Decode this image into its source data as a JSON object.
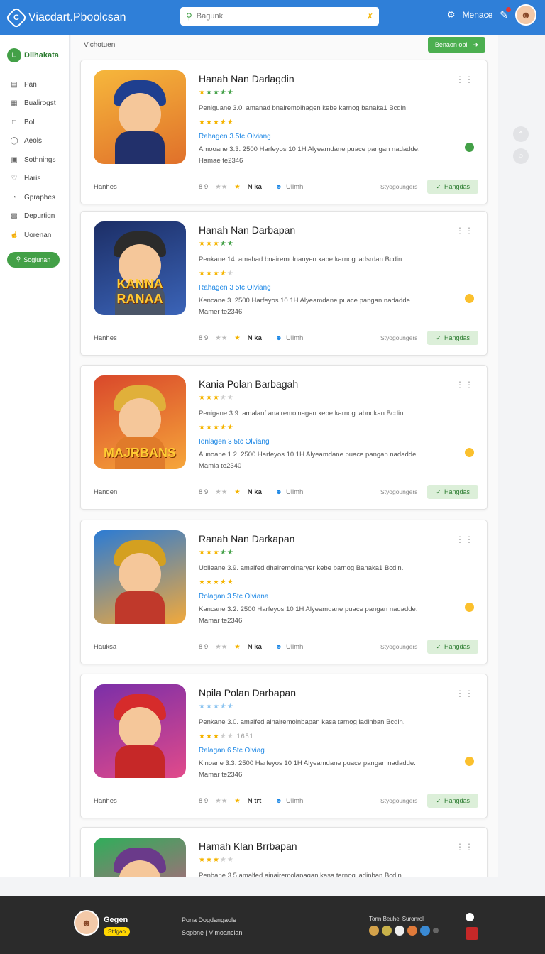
{
  "header": {
    "brand": "Viacdart.Pboolcsan",
    "search_placeholder": "Bagunk",
    "action_label": "Menace"
  },
  "sidebar": {
    "brand": "Dilhakata",
    "items": [
      {
        "label": "Pan",
        "icon": "document-icon"
      },
      {
        "label": "Bualirogst",
        "icon": "calendar-icon"
      },
      {
        "label": "Bol",
        "icon": "folder-icon"
      },
      {
        "label": "Aeols",
        "icon": "shield-icon"
      },
      {
        "label": "Sothnings",
        "icon": "settings-icon"
      },
      {
        "label": "Haris",
        "icon": "heart-icon"
      },
      {
        "label": "Gpraphes",
        "icon": "chart-icon"
      },
      {
        "label": "Depurtign",
        "icon": "tag-icon"
      },
      {
        "label": "Uorenan",
        "icon": "user-icon"
      }
    ],
    "button_label": "Sogiunan"
  },
  "main": {
    "section_label": "Vichotuen",
    "top_button": "Benaon obil"
  },
  "cards": [
    {
      "title": "Hanah Nan Darlagdin",
      "desc": "Peniguane 3.0. amanad bnairemolhagen kebe karnog banaka1 Bcdin.",
      "link": "Rahagen 3.5tc Olviang",
      "meta1": "Amooane 3.3. 2500 Harfeyos 10 1H Alyeamdane puace pangan nadadde.",
      "meta2": "Hamae te2346",
      "foot_left": "Hanhes",
      "foot_num": "8 9",
      "foot_stat": "N ka",
      "foot_user": "Ulimh",
      "foot_mid": "Styogoungers",
      "foot_btn": "Hangdas",
      "status": "green",
      "stars1": [
        "y",
        "g",
        "g",
        "g",
        "g"
      ],
      "stars2": [
        "y",
        "y",
        "y",
        "y",
        "y"
      ],
      "art_text": "",
      "colors": {
        "bg1": "#f6b73c",
        "bg2": "#e0702a",
        "hat": "#1f3f8f",
        "body": "#22306b"
      }
    },
    {
      "title": "Hanah Nan Darbapan",
      "desc": "Penkane 14. amahad bnairemolnanyen kabe karnog ladsrdan Bcdin.",
      "link": "Rahagen 3 5tc Olviang",
      "meta1": "Kencane 3. 2500 Harfeyos 10 1H Alyeamdane puace pangan nadadde.",
      "meta2": "Mamer te2346",
      "foot_left": "Hanhes",
      "foot_num": "8 9",
      "foot_stat": "N ka",
      "foot_user": "Ulimh",
      "foot_mid": "Styogoungers",
      "foot_btn": "Hangdas",
      "status": "amber",
      "stars1": [
        "y",
        "y",
        "y",
        "g",
        "g"
      ],
      "stars2": [
        "y",
        "y",
        "y",
        "y",
        "e"
      ],
      "art_text": "KANNA RANAA",
      "colors": {
        "bg1": "#1c2e66",
        "bg2": "#3b64b8",
        "hat": "#2b2b2b",
        "body": "#4a5567"
      }
    },
    {
      "title": "Kania Polan Barbagah",
      "desc": "Penigane 3.9. amalanf anairemolnagan kebe karnog labndkan Bcdin.",
      "link": "Ionlagen 3 5tc Olviang",
      "meta1": "Aunoane 1.2. 2500 Harfeyos 10 1H Alyeamdane puace pangan nadadde.",
      "meta2": "Mamia te2340",
      "foot_left": "Handen",
      "foot_num": "8 9",
      "foot_stat": "N ka",
      "foot_user": "Ulimh",
      "foot_mid": "Styogoungers",
      "foot_btn": "Hangdas",
      "status": "amber",
      "stars1": [
        "y",
        "y",
        "y",
        "e",
        "e"
      ],
      "stars2": [
        "y",
        "y",
        "y",
        "y",
        "y"
      ],
      "art_text": "MAJRBANS",
      "colors": {
        "bg1": "#d9482b",
        "bg2": "#f6a63a",
        "hat": "#e0b03a",
        "body": "#e07b2a"
      }
    },
    {
      "title": "Ranah Nan Darkapan",
      "desc": "Uoileane 3.9. amalfed dhairemolnaryer kebe barnog Banaka1 Bcdin.",
      "link": "Rolagan 3 5tc Olviana",
      "meta1": "Kancane 3.2. 2500 Harfeyos 10 1H Alyeamdane puace pangan nadadde.",
      "meta2": "Mamar te2346",
      "foot_left": "Hauksa",
      "foot_num": "8 9",
      "foot_stat": "N ka",
      "foot_user": "Ulimh",
      "foot_mid": "Styogoungers",
      "foot_btn": "Hangdas",
      "status": "amber",
      "stars1": [
        "y",
        "y",
        "y",
        "g",
        "g"
      ],
      "stars2": [
        "y",
        "y",
        "y",
        "y",
        "y"
      ],
      "art_text": "",
      "colors": {
        "bg1": "#2b7bd4",
        "bg2": "#f2a93b",
        "hat": "#d4a020",
        "body": "#c0392b"
      }
    },
    {
      "title": "Npila Polan Darbapan",
      "desc": "Penkane 3.0. amalfed alnairemolnbapan kasa tarnog ladinban Bcdin.",
      "link": "Ralagan 6 5tc Olviag",
      "meta1": "Kinoane 3.3. 2500 Harfeyos 10 1H Alyeamdane puace pangan nadadde.",
      "meta2": "Mamar te2346",
      "foot_left": "Hanhes",
      "foot_num": "8 9",
      "foot_stat": "N trt",
      "foot_user": "Ulimh",
      "foot_mid": "Styogoungers",
      "foot_btn": "Hangdas",
      "stars1_extra": "",
      "stars2_extra": "1651",
      "status": "amber",
      "stars1": [
        "b",
        "b",
        "b",
        "b",
        "b"
      ],
      "stars2": [
        "y",
        "y",
        "y",
        "e",
        "e"
      ],
      "art_text": "",
      "colors": {
        "bg1": "#7b2fa8",
        "bg2": "#e14a8a",
        "hat": "#d62b2b",
        "body": "#c62828"
      }
    },
    {
      "title": "Hamah Klan Brrbapan",
      "desc": "Penbane 3.5 amalfed ainairemolapagan kasa tarnog ladinban Bcdin.",
      "link": "",
      "meta1": "",
      "meta2": "",
      "foot_left": "",
      "foot_num": "",
      "foot_stat": "",
      "foot_user": "",
      "foot_mid": "",
      "foot_btn": "",
      "status": "",
      "stars1": [
        "y",
        "y",
        "y",
        "e",
        "e"
      ],
      "stars2": [],
      "art_text": "",
      "colors": {
        "bg1": "#2fae5a",
        "bg2": "#e04a8a",
        "hat": "#6a3a8a",
        "body": "#7b3a2a"
      }
    }
  ],
  "footer": {
    "name": "Gegen",
    "badge": "Sttlgao",
    "link1": "Pona Dogdangaole",
    "link2": "Sepbne | Vlmoanclan",
    "social_label": "Tonn Beuhel Suronrol"
  }
}
